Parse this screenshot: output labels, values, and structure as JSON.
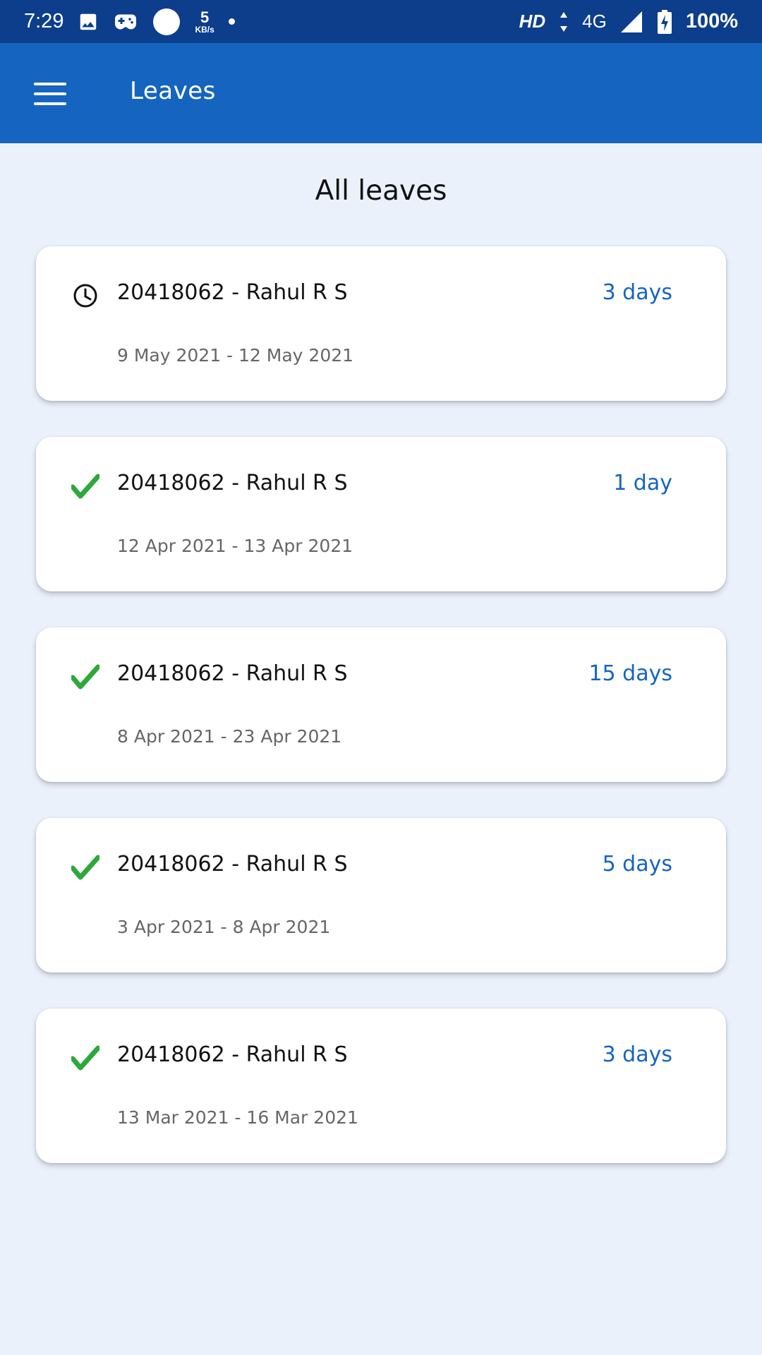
{
  "status_bar": {
    "time": "7:29",
    "net_speed_value": "5",
    "net_speed_unit": "KB/s",
    "hd_label": "HD",
    "network_type": "4G",
    "battery": "100%"
  },
  "app_bar": {
    "menu_icon": "hamburger-menu-icon",
    "title": "Leaves"
  },
  "section_title": "All leaves",
  "colors": {
    "status_bar": "#0D3E8C",
    "app_bar": "#1565C0",
    "background": "#EAF1FB",
    "duration_text": "#1565C0",
    "approved_check": "#2EA83A"
  },
  "leaves": [
    {
      "status": "pending",
      "status_icon": "clock-icon",
      "name": "20418062 - Rahul R S",
      "duration": "3 days",
      "dates": "9 May 2021 - 12 May 2021"
    },
    {
      "status": "approved",
      "status_icon": "check-icon",
      "name": "20418062 - Rahul R S",
      "duration": "1 day",
      "dates": "12 Apr 2021 - 13 Apr 2021"
    },
    {
      "status": "approved",
      "status_icon": "check-icon",
      "name": "20418062 - Rahul R S",
      "duration": "15 days",
      "dates": "8 Apr 2021 - 23 Apr 2021"
    },
    {
      "status": "approved",
      "status_icon": "check-icon",
      "name": "20418062 - Rahul R S",
      "duration": "5 days",
      "dates": "3 Apr 2021 - 8 Apr 2021"
    },
    {
      "status": "approved",
      "status_icon": "check-icon",
      "name": "20418062 - Rahul R S",
      "duration": "3 days",
      "dates": "13 Mar 2021 - 16 Mar 2021"
    }
  ]
}
